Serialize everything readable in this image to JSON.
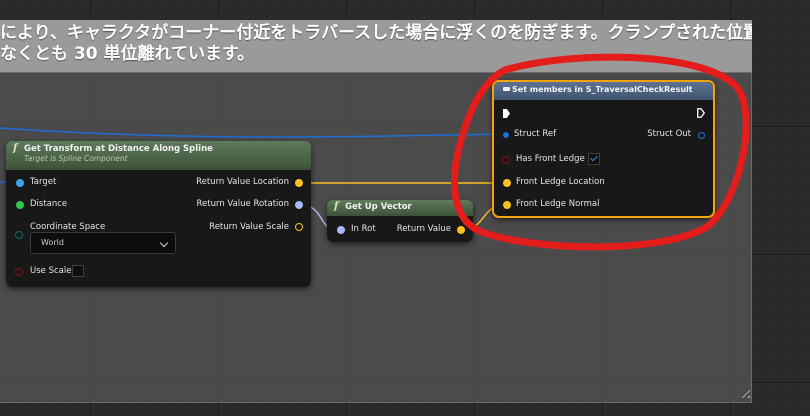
{
  "comment": {
    "line1": "により、キャラクタがコーナー付近をトラバースした場合に浮くのを防ぎます。クランプされた位置",
    "line2": "なくとも 30 単位離れています。"
  },
  "node_transform": {
    "title": "Get Transform at Distance Along Spline",
    "subtitle": "Target is Spline Component",
    "inputs": {
      "target": "Target",
      "distance": "Distance",
      "coordinate_space": "Coordinate Space",
      "coordinate_space_value": "World",
      "use_scale": "Use Scale"
    },
    "outputs": {
      "location": "Return Value Location",
      "rotation": "Return Value Rotation",
      "scale": "Return Value Scale"
    }
  },
  "node_upvector": {
    "title": "Get Up Vector",
    "input": "In Rot",
    "output": "Return Value"
  },
  "node_setmembers": {
    "title": "Set members in S_TraversalCheckResult",
    "struct_ref": "Struct Ref",
    "struct_out": "Struct Out",
    "has_front_ledge": "Has Front Ledge",
    "has_front_ledge_checked": true,
    "front_ledge_location": "Front Ledge Location",
    "front_ledge_normal": "Front Ledge Normal"
  },
  "colors": {
    "vector_pin": "#f6c21e",
    "rotator_pin": "#a8b8f2",
    "struct_pin": "#1f6fd6",
    "float_pin": "#2ec94a",
    "bool_pin": "#8a0f0f",
    "enum_pin": "#0e5e58",
    "annotation": "#e31c1c"
  }
}
